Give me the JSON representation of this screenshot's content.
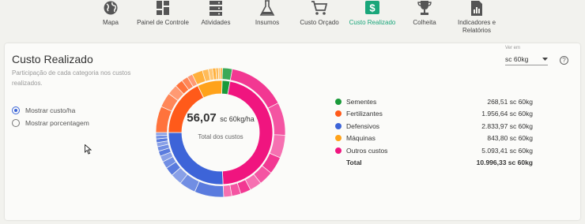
{
  "nav": {
    "items": [
      {
        "label": "Mapa",
        "icon": "globe-icon"
      },
      {
        "label": "Painel de Controle",
        "icon": "dashboard-icon"
      },
      {
        "label": "Atividades",
        "icon": "tasks-icon"
      },
      {
        "label": "Insumos",
        "icon": "flask-icon"
      },
      {
        "label": "Custo Orçado",
        "icon": "cart-icon"
      },
      {
        "label": "Custo Realizado",
        "icon": "dollar-icon",
        "active": true
      },
      {
        "label": "Colheita",
        "icon": "trophy-icon"
      },
      {
        "label": "Indicadores e Relatórios",
        "icon": "report-icon"
      }
    ],
    "active_color": "#19a67a"
  },
  "card": {
    "title": "Custo Realizado",
    "subtitle": "Participação de cada categoria nos custos realizados.",
    "options": [
      {
        "label": "Mostrar custo/ha",
        "selected": true
      },
      {
        "label": "Mostrar porcentagem",
        "selected": false
      }
    ],
    "ver_em_label": "Ver em",
    "unit_select": "sc 60kg",
    "help_symbol": "?"
  },
  "donut": {
    "center_value": "56,07",
    "center_unit": "sc 60kg/ha",
    "center_label": "Total dos custos"
  },
  "legend": {
    "rows": [
      {
        "name": "Sementes",
        "value": "268,51 sc 60kg",
        "color": "#1a9a3a"
      },
      {
        "name": "Fertilizantes",
        "value": "1.956,64 sc 60kg",
        "color": "#ff5a1a"
      },
      {
        "name": "Defensivos",
        "value": "2.833,97 sc 60kg",
        "color": "#3d64d8"
      },
      {
        "name": "Máquinas",
        "value": "843,80 sc 60kg",
        "color": "#ffa21a"
      },
      {
        "name": "Outros custos",
        "value": "5.093,41 sc 60kg",
        "color": "#f0157f"
      }
    ],
    "total_label": "Total",
    "total_value": "10.996,33 sc 60kg"
  }
}
